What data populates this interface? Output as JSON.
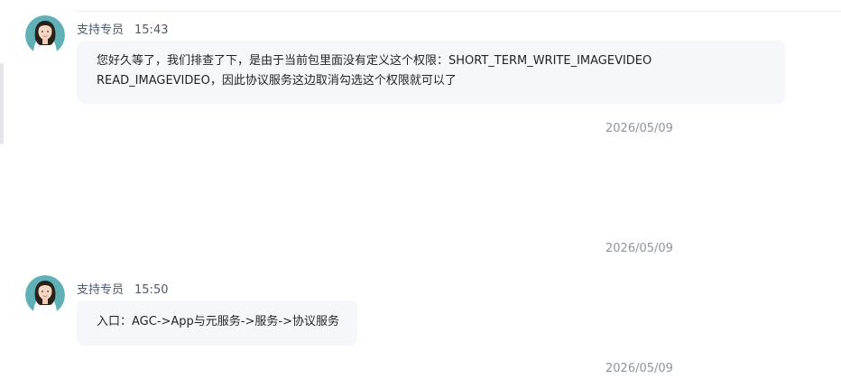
{
  "messages": [
    {
      "sender": "支持专员",
      "time": "15:43",
      "text": "您好久等了，我们排查了下，是由于当前包里面没有定义这个权限：SHORT_TERM_WRITE_IMAGEVIDEO  READ_IMAGEVIDEO，因此协议服务这边取消勾选这个权限就可以了"
    },
    {
      "sender": "支持专员",
      "time": "15:50",
      "text": "入口：AGC->App与元服务->服务->协议服务"
    }
  ],
  "dates": [
    "2026/05/09",
    "2026/05/09",
    "2026/05/09"
  ],
  "colors": {
    "bubble": "#f5f7fa",
    "avatar_bg": "#5fb0b7",
    "date_text": "#8f959e"
  },
  "icons": {
    "avatar": "support-agent-avatar"
  }
}
